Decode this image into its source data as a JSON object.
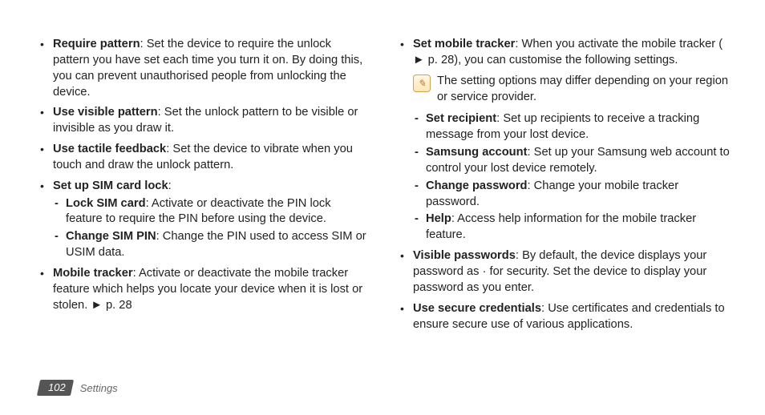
{
  "left": {
    "items": [
      {
        "term": "Require pattern",
        "desc": ": Set the device to require the unlock pattern you have set each time you turn it on. By doing this, you can prevent unauthorised people from unlocking the device."
      },
      {
        "term": "Use visible pattern",
        "desc": ": Set the unlock pattern to be visible or invisible as you draw it."
      },
      {
        "term": "Use tactile feedback",
        "desc": ": Set the device to vibrate when you touch and draw the unlock pattern."
      },
      {
        "term": "Set up SIM card lock",
        "desc": ":",
        "sub": [
          {
            "term": "Lock SIM card",
            "desc": ": Activate or deactivate the PIN lock feature to require the PIN before using the device."
          },
          {
            "term": "Change SIM PIN",
            "desc": ": Change the PIN used to access SIM or USIM data."
          }
        ]
      },
      {
        "term": "Mobile tracker",
        "desc": ": Activate or deactivate the mobile tracker feature which helps you locate your device when it is lost or stolen. ► p. 28"
      }
    ]
  },
  "right": {
    "items": [
      {
        "term": "Set mobile tracker",
        "desc": ": When you activate the mobile tracker ( ► p. 28), you can customise the following settings.",
        "note": "The setting options may differ depending on your region or service provider.",
        "sub": [
          {
            "term": "Set recipient",
            "desc": ": Set up recipients to receive a tracking message from your lost device."
          },
          {
            "term": "Samsung account",
            "desc": ": Set up your Samsung web account to control your lost device remotely."
          },
          {
            "term": "Change password",
            "desc": ": Change your mobile tracker password."
          },
          {
            "term": "Help",
            "desc": ": Access help information for the mobile tracker feature."
          }
        ]
      },
      {
        "term": "Visible passwords",
        "desc": ": By default, the device displays your password as · for security. Set the device to display your password as you enter."
      },
      {
        "term": "Use secure credentials",
        "desc": ": Use certificates and credentials to ensure secure use of various applications."
      }
    ]
  },
  "footer": {
    "page": "102",
    "section": "Settings"
  },
  "note_icon_glyph": "✎"
}
